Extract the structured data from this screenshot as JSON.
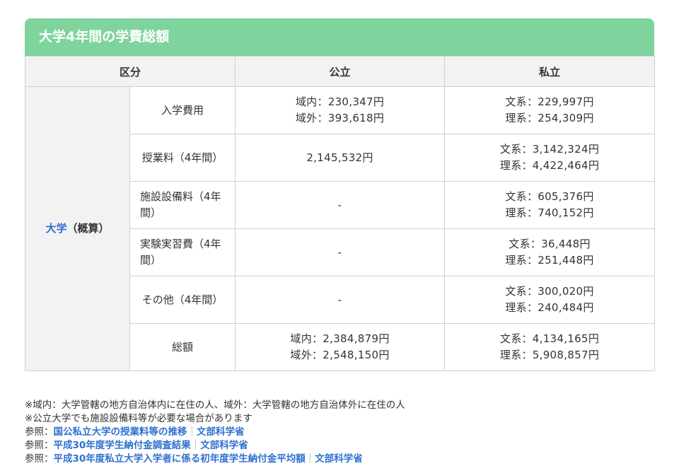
{
  "title": "大学4年間の学費総額",
  "table": {
    "headers": {
      "category": "区分",
      "public": "公立",
      "private": "私立"
    },
    "group": {
      "link": "大学",
      "suffix": "（概算）"
    },
    "rows": [
      {
        "label": "入学費用",
        "public": [
          "域内：230,347円",
          "域外：393,618円"
        ],
        "private": [
          "文系：229,997円",
          "理系：254,309円"
        ]
      },
      {
        "label": "授業料（4年間）",
        "public": [
          "2,145,532円"
        ],
        "private": [
          "文系：3,142,324円",
          "理系：4,422,464円"
        ]
      },
      {
        "label": "施設設備料（4年間）",
        "public": [
          "-"
        ],
        "private": [
          "文系：605,376円",
          "理系：740,152円"
        ]
      },
      {
        "label": "実験実習費（4年間）",
        "public": [
          "-"
        ],
        "private": [
          "文系：36,448円",
          "理系：251,448円"
        ]
      },
      {
        "label": "その他（4年間）",
        "public": [
          "-"
        ],
        "private": [
          "文系：300,020円",
          "理系：240,484円"
        ]
      },
      {
        "label": "総額",
        "public": [
          "域内：2,384,879円",
          "域外：2,548,150円"
        ],
        "private": [
          "文系：4,134,165円",
          "理系：5,908,857円"
        ]
      }
    ]
  },
  "notes": [
    "※域内：大学管轄の地方自治体内に在住の人、域外：大学管轄の地方自治体外に在住の人",
    "※公立大学でも施設設備料等が必要な場合があります"
  ],
  "references": [
    {
      "prefix": "参照：",
      "title": "国公私立大学の授業料等の推移",
      "separator": "｜",
      "source": "文部科学省"
    },
    {
      "prefix": "参照：",
      "title": "平成30年度学生納付金調査結果",
      "separator": "｜",
      "source": "文部科学省"
    },
    {
      "prefix": "参照：",
      "title": "平成30年度私立大学入学者に係る初年度学生納付金平均額",
      "separator": "｜",
      "source": "文部科学省"
    }
  ],
  "colors": {
    "accent": "#7fd49d",
    "link": "#2f70cf",
    "header_bg": "#f2f2f2",
    "border": "#d0d0d0",
    "text": "#333333",
    "separator": "#a0a0a0"
  }
}
